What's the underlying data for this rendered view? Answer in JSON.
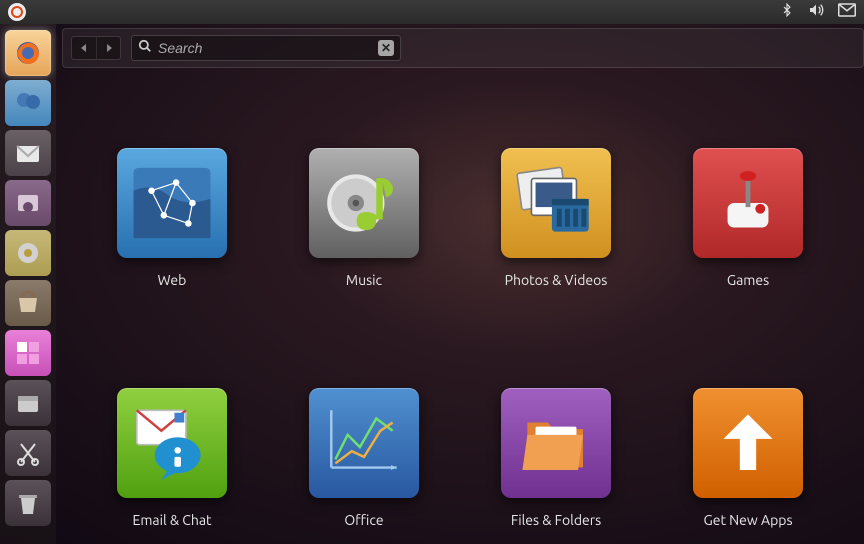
{
  "search": {
    "placeholder": "Search"
  },
  "launcher": [
    {
      "name": "firefox",
      "cls": "li-firefox",
      "active": true
    },
    {
      "name": "balloons",
      "cls": "li-blue"
    },
    {
      "name": "mail",
      "cls": "li-gray1"
    },
    {
      "name": "photos",
      "cls": "li-purple"
    },
    {
      "name": "music-store",
      "cls": "li-yellow"
    },
    {
      "name": "software-center",
      "cls": "li-brown"
    },
    {
      "name": "workspace",
      "cls": "li-pink"
    },
    {
      "name": "files",
      "cls": "li-gray2"
    },
    {
      "name": "scissors",
      "cls": "li-gray3"
    },
    {
      "name": "trash",
      "cls": "li-gray4"
    }
  ],
  "dash": [
    {
      "id": "web",
      "label": "Web",
      "tile": "tile-web"
    },
    {
      "id": "music",
      "label": "Music",
      "tile": "tile-music"
    },
    {
      "id": "photos",
      "label": "Photos & Videos",
      "tile": "tile-photos"
    },
    {
      "id": "games",
      "label": "Games",
      "tile": "tile-games"
    },
    {
      "id": "email",
      "label": "Email & Chat",
      "tile": "tile-email"
    },
    {
      "id": "office",
      "label": "Office",
      "tile": "tile-office"
    },
    {
      "id": "files",
      "label": "Files & Folders",
      "tile": "tile-files"
    },
    {
      "id": "apps",
      "label": "Get New Apps",
      "tile": "tile-apps"
    }
  ]
}
